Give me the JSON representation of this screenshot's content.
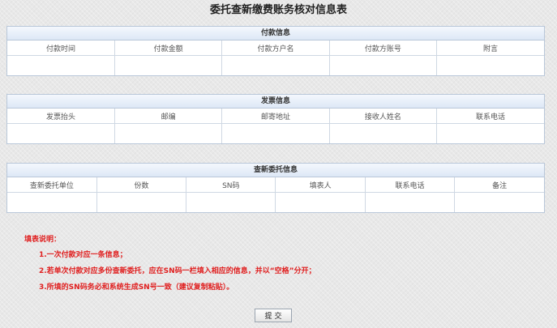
{
  "title": "委托查新缴费账务核对信息表",
  "payment": {
    "header": "付款信息",
    "columns": [
      "付款时间",
      "付款金额",
      "付款方户名",
      "付款方账号",
      "附言"
    ]
  },
  "invoice": {
    "header": "发票信息",
    "columns": [
      "发票抬头",
      "邮编",
      "邮寄地址",
      "接收人姓名",
      "联系电话"
    ]
  },
  "commission": {
    "header": "查新委托信息",
    "columns": [
      "查新委托单位",
      "份数",
      "SN码",
      "填表人",
      "联系电话",
      "备注"
    ]
  },
  "notes": {
    "title": "填表说明：",
    "items": [
      "1.一次付款对应一条信息；",
      "2.若单次付款对应多份查新委托，应在SN码一栏填入相应的信息，并以“空格”分开；",
      "3.所填的SN码务必和系统生成SN号一致（建议复制粘贴）。"
    ]
  },
  "submit_label": "提交",
  "colors": {
    "accent_red": "#e02020",
    "header_blue": "#dde8f6",
    "border": "#b9c7d9"
  }
}
